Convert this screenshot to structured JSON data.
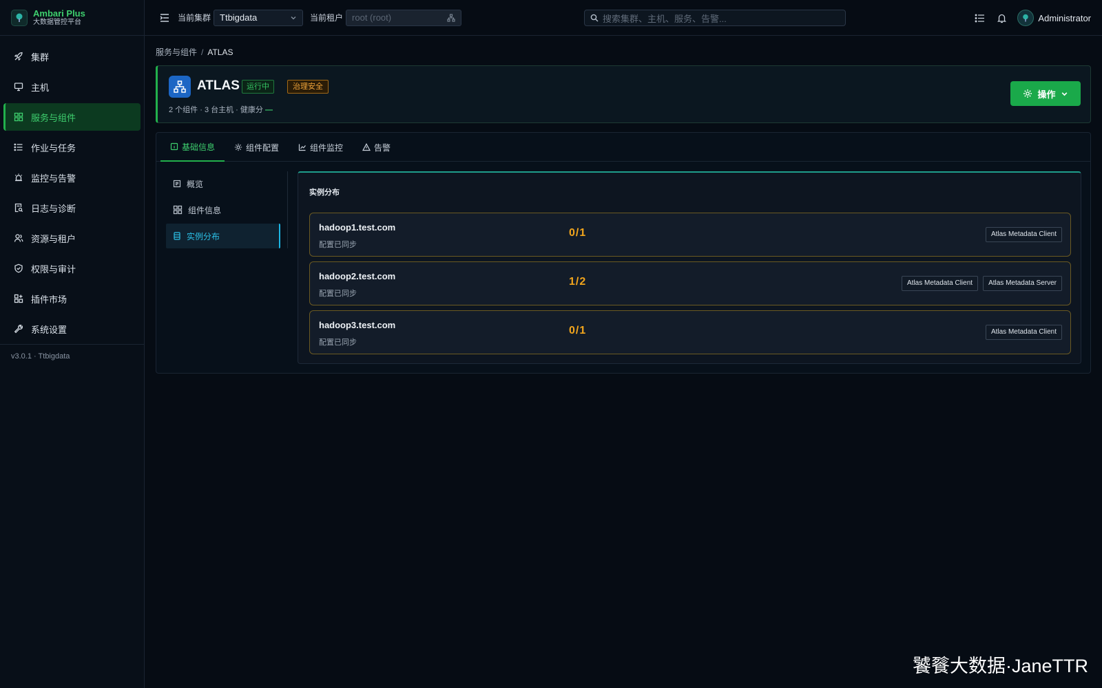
{
  "brand": {
    "name": "Ambari Plus",
    "subtitle": "大数据管控平台"
  },
  "sidebar": {
    "items": [
      {
        "label": "集群",
        "icon": "rocket-icon",
        "active": false
      },
      {
        "label": "主机",
        "icon": "monitor-icon",
        "active": false
      },
      {
        "label": "服务与组件",
        "icon": "grid-icon",
        "active": true
      },
      {
        "label": "作业与任务",
        "icon": "list-icon",
        "active": false
      },
      {
        "label": "监控与告警",
        "icon": "alarm-icon",
        "active": false
      },
      {
        "label": "日志与诊断",
        "icon": "file-search-icon",
        "active": false
      },
      {
        "label": "资源与租户",
        "icon": "users-icon",
        "active": false
      },
      {
        "label": "权限与审计",
        "icon": "shield-icon",
        "active": false
      },
      {
        "label": "插件市场",
        "icon": "plugin-icon",
        "active": false
      },
      {
        "label": "系统设置",
        "icon": "wrench-icon",
        "active": false
      }
    ],
    "version": "v3.0.1 · Ttbigdata"
  },
  "topbar": {
    "cluster_label": "当前集群",
    "cluster_value": "Ttbigdata",
    "tenant_label": "当前租户",
    "tenant_placeholder": "root (root)",
    "search_placeholder": "搜索集群、主机、服务、告警...",
    "username": "Administrator"
  },
  "breadcrumb": {
    "parent": "服务与组件",
    "separator": "/",
    "current": "ATLAS"
  },
  "service": {
    "name": "ATLAS",
    "status": "运行中",
    "category": "治理安全",
    "meta": "2 个组件 · 3 台主机 · 健康分",
    "health": "—",
    "action_label": "操作"
  },
  "tabs": [
    {
      "label": "基础信息",
      "icon": "info-icon",
      "active": true
    },
    {
      "label": "组件配置",
      "icon": "gear-icon",
      "active": false
    },
    {
      "label": "组件监控",
      "icon": "line-chart-icon",
      "active": false
    },
    {
      "label": "告警",
      "icon": "warning-icon",
      "active": false
    }
  ],
  "subnav": [
    {
      "label": "概览",
      "icon": "doc-icon",
      "active": false
    },
    {
      "label": "组件信息",
      "icon": "grid-icon",
      "active": false
    },
    {
      "label": "实例分布",
      "icon": "server-icon",
      "active": true
    }
  ],
  "distribution": {
    "title": "实例分布",
    "hosts": [
      {
        "name": "hadoop1.test.com",
        "status": "配置已同步",
        "count": "0/1",
        "components": [
          "Atlas Metadata Client"
        ]
      },
      {
        "name": "hadoop2.test.com",
        "status": "配置已同步",
        "count": "1/2",
        "components": [
          "Atlas Metadata Client",
          "Atlas Metadata Server"
        ]
      },
      {
        "name": "hadoop3.test.com",
        "status": "配置已同步",
        "count": "0/1",
        "components": [
          "Atlas Metadata Client"
        ]
      }
    ]
  },
  "watermark": "饕餮大数据·JaneTTR",
  "colors": {
    "accent": "#22b14c",
    "accent_text": "#3ecf6e",
    "cyan": "#1cb6e4",
    "count": "#f2a51c",
    "background": "#060c14"
  }
}
